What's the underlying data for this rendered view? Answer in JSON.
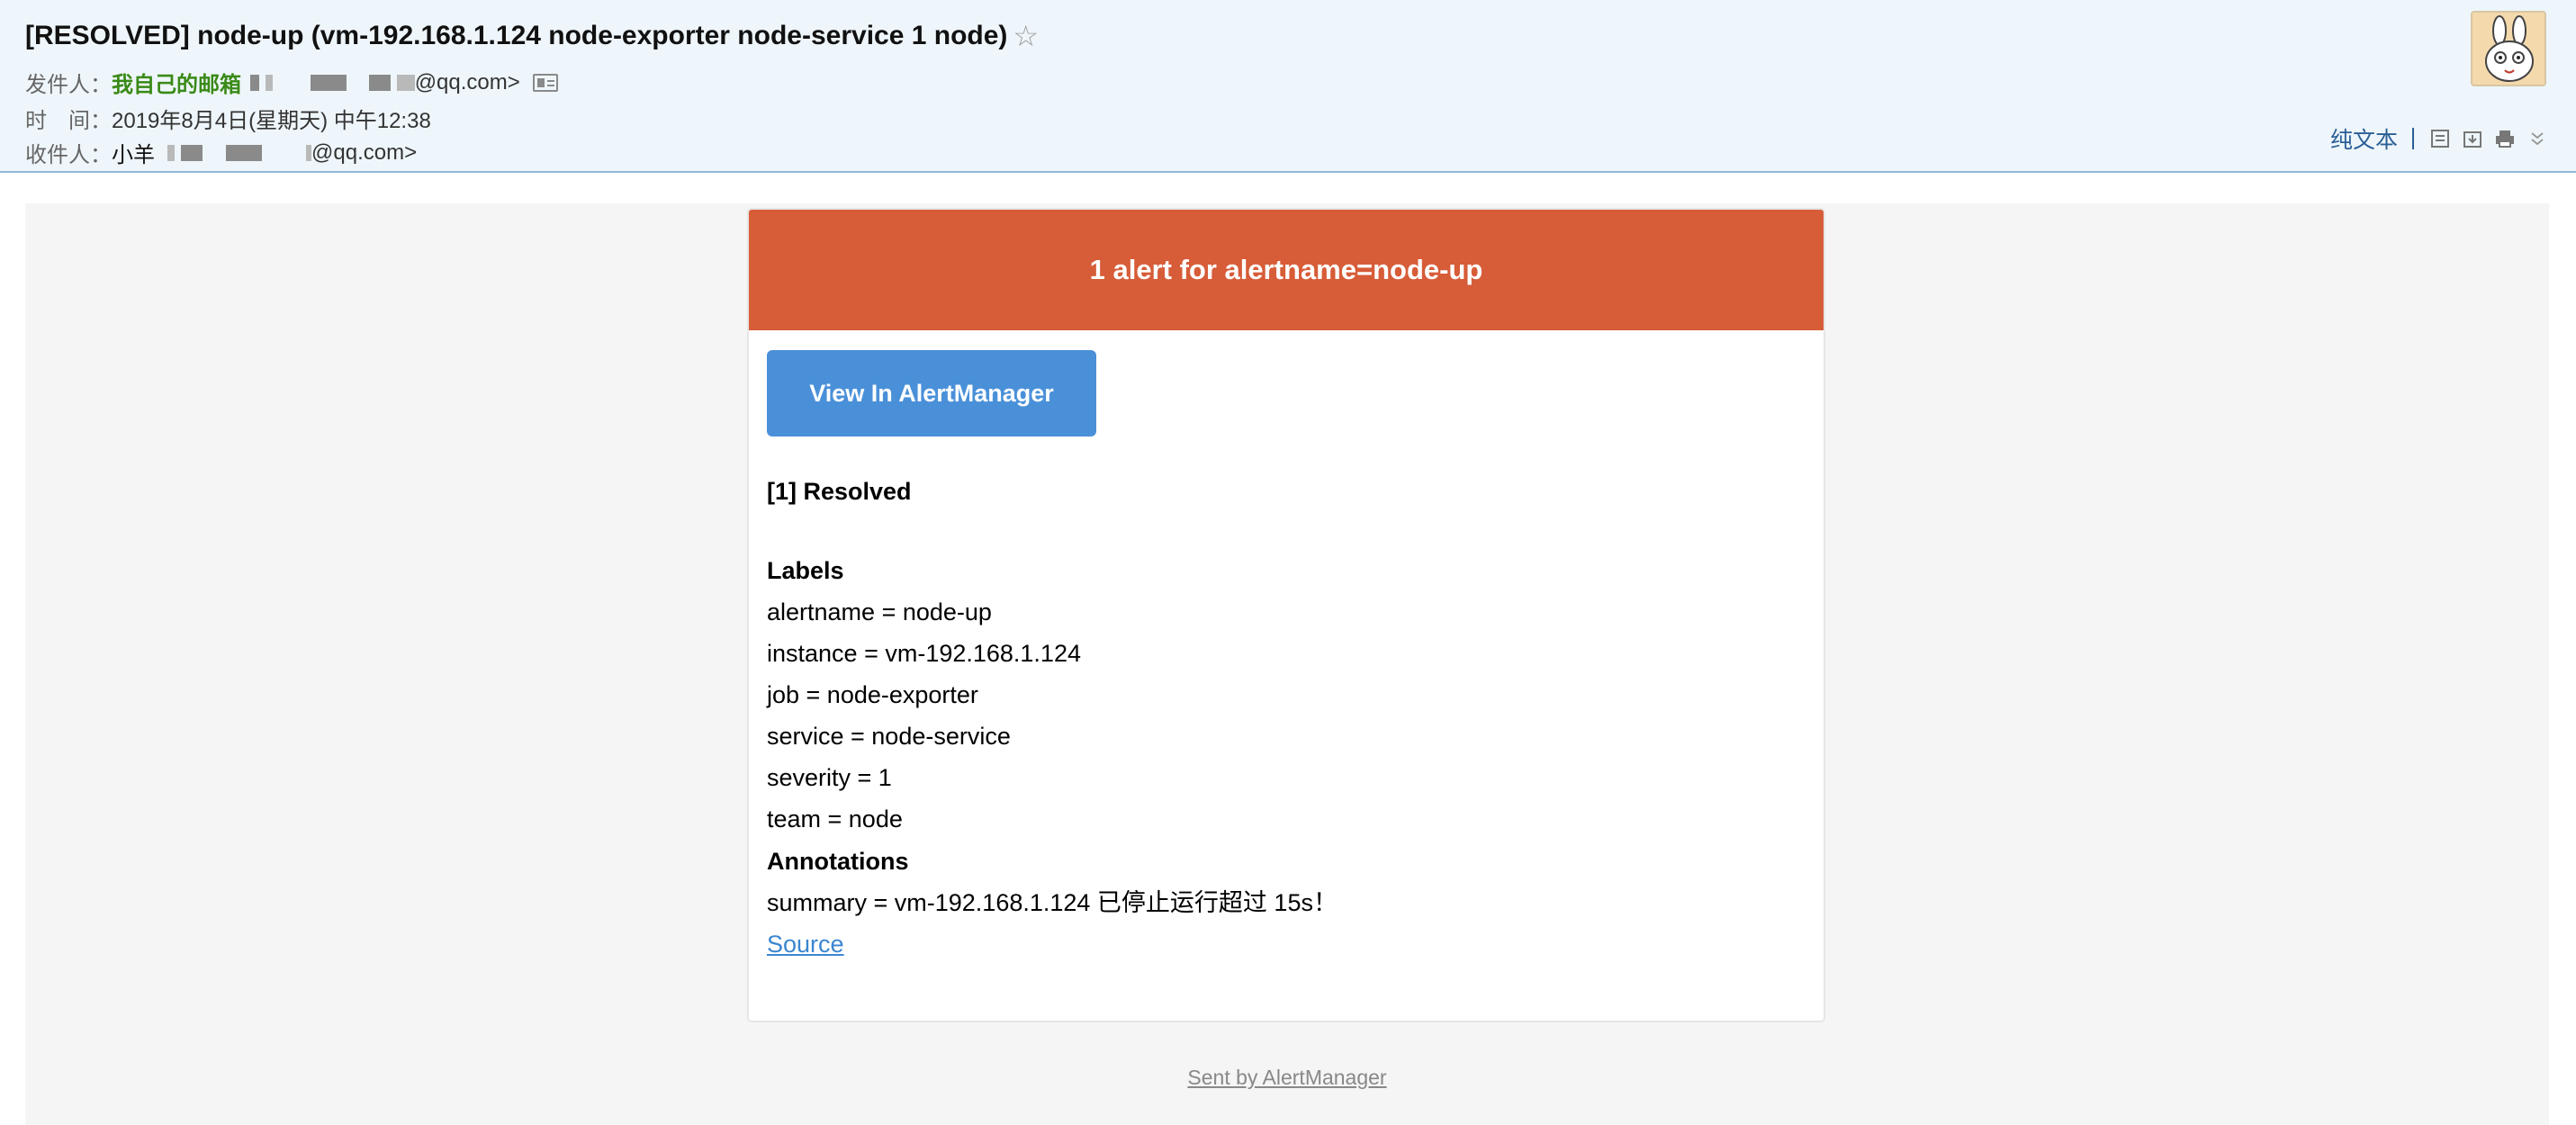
{
  "header": {
    "subject": "[RESOLVED] node-up (vm-192.168.1.124 node-exporter node-service 1 node)",
    "star_glyph": "☆",
    "sender_label": "发件人：",
    "sender_name": "我自己的邮箱",
    "sender_email_suffix": "@qq.com>",
    "time_label": "时　间：",
    "time_value": "2019年8月4日(星期天) 中午12:38",
    "recipient_label": "收件人：",
    "recipient_name": "小羊",
    "recipient_email_suffix": "@qq.com>",
    "plain_text_label": "纯文本",
    "toolbar_icons": [
      "note-icon",
      "download-icon",
      "print-icon",
      "chevron-down-icon"
    ]
  },
  "alert": {
    "banner_title": "1 alert for alertname=node-up",
    "button_label": "View In AlertManager",
    "resolved_heading": "[1] Resolved",
    "labels_heading": "Labels",
    "labels": [
      "alertname = node-up",
      "instance = vm-192.168.1.124",
      "job = node-exporter",
      "service = node-service",
      "severity = 1",
      "team = node"
    ],
    "annotations_heading": "Annotations",
    "annotations": [
      "summary = vm-192.168.1.124 已停止运行超过 15s！"
    ],
    "source_link": "Source"
  },
  "footer": {
    "sent_by": "Sent by AlertManager"
  },
  "colors": {
    "banner": "#d75c38",
    "button": "#4a90d9",
    "header_bg": "#eef6fb",
    "sender_name": "#3a8a17",
    "link": "#3b86d0"
  }
}
